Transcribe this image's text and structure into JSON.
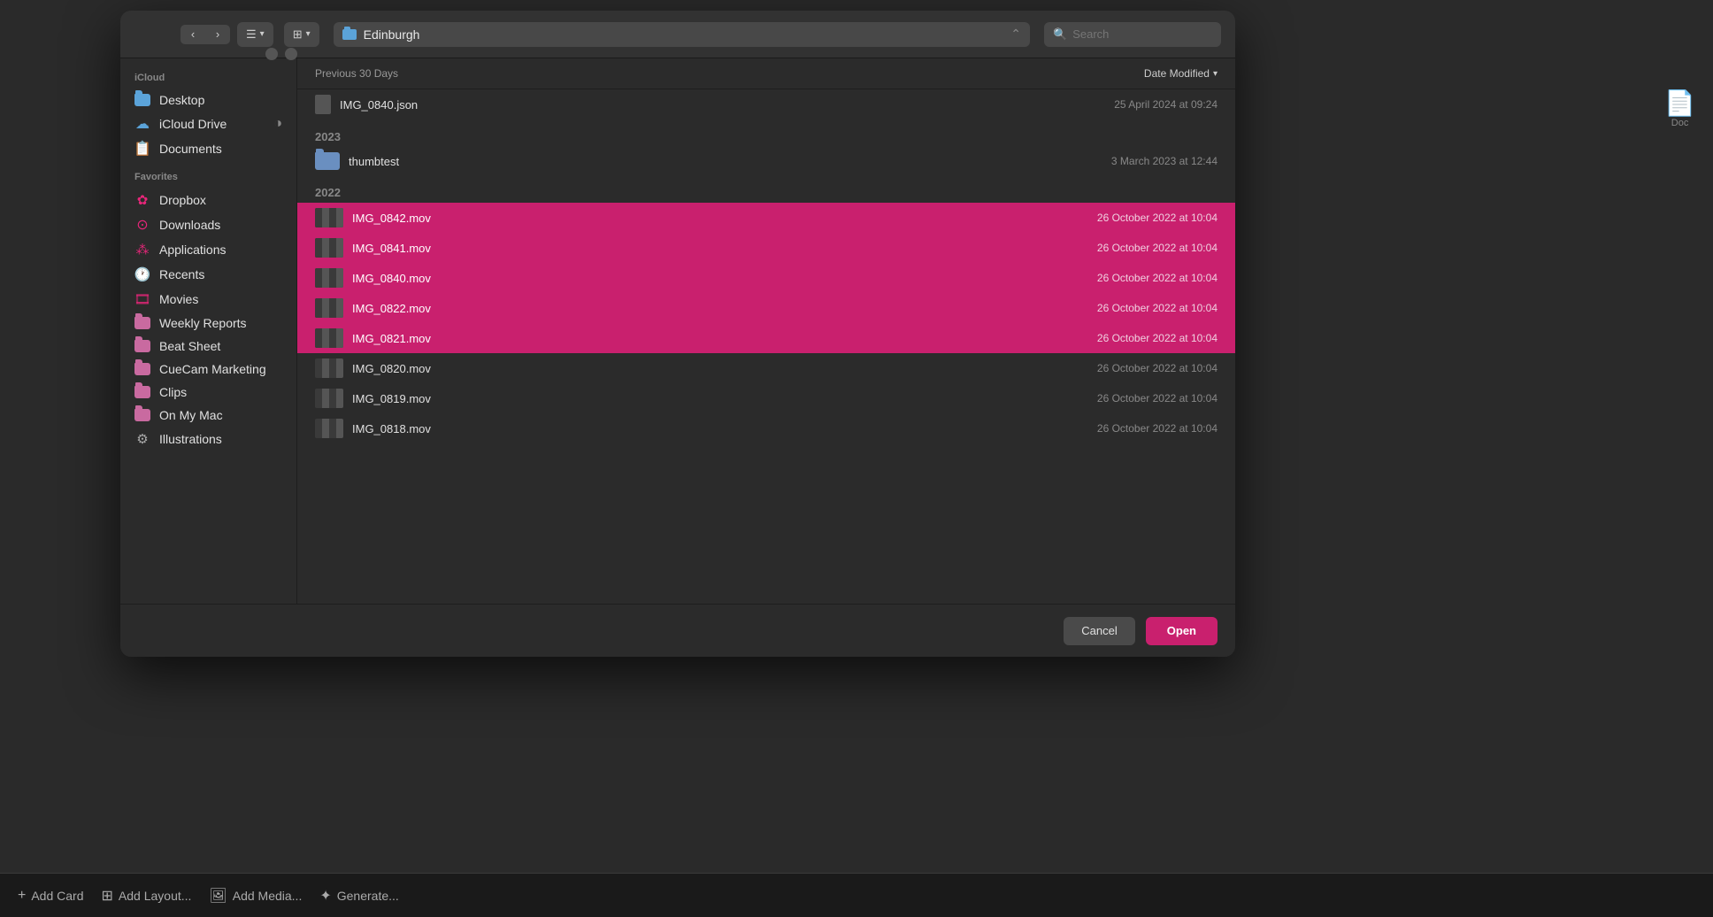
{
  "background": {
    "toolbar": {
      "items": [
        {
          "icon": "+",
          "label": "Add Card"
        },
        {
          "icon": "⊞",
          "label": "Add Layout..."
        },
        {
          "icon": "🖼",
          "label": "Add Media..."
        },
        {
          "icon": "✦",
          "label": "Generate..."
        }
      ]
    }
  },
  "dialog": {
    "toolbar": {
      "back_label": "‹",
      "forward_label": "›",
      "list_view_label": "☰",
      "grid_view_label": "⊞",
      "location": "Edinburgh",
      "search_placeholder": "Search"
    },
    "content_header": {
      "section_label": "Previous 30 Days",
      "date_col_label": "Date Modified"
    },
    "sidebar": {
      "icloud_section": "iCloud",
      "icloud_items": [
        {
          "id": "desktop",
          "label": "Desktop",
          "icon_type": "folder-blue"
        },
        {
          "id": "icloud-drive",
          "label": "iCloud Drive",
          "icon_type": "cloud"
        },
        {
          "id": "documents",
          "label": "Documents",
          "icon_type": "doc"
        }
      ],
      "favorites_section": "Favorites",
      "favorites_items": [
        {
          "id": "dropbox",
          "label": "Dropbox",
          "icon_type": "dropbox"
        },
        {
          "id": "downloads",
          "label": "Downloads",
          "icon_type": "downloads"
        },
        {
          "id": "applications",
          "label": "Applications",
          "icon_type": "grid"
        },
        {
          "id": "recents",
          "label": "Recents",
          "icon_type": "clock"
        },
        {
          "id": "movies",
          "label": "Movies",
          "icon_type": "film"
        },
        {
          "id": "weekly-reports",
          "label": "Weekly Reports",
          "icon_type": "folder"
        },
        {
          "id": "beat-sheet",
          "label": "Beat Sheet",
          "icon_type": "folder"
        },
        {
          "id": "cuecam-marketing",
          "label": "CueCam Marketing",
          "icon_type": "folder"
        },
        {
          "id": "clips",
          "label": "Clips",
          "icon_type": "folder"
        },
        {
          "id": "on-my-mac",
          "label": "On My Mac",
          "icon_type": "folder"
        },
        {
          "id": "illustrations",
          "label": "Illustrations",
          "icon_type": "gear"
        }
      ]
    },
    "file_groups": [
      {
        "year": "Previous 30 Days",
        "files": [
          {
            "id": "img0840-json",
            "name": "IMG_0840.json",
            "date": "25 April 2024 at 09:24",
            "type": "json",
            "selected": false
          }
        ]
      },
      {
        "year": "2023",
        "files": [
          {
            "id": "thumbtest",
            "name": "thumbtest",
            "date": "3 March 2023 at 12:44",
            "type": "folder",
            "selected": false
          }
        ]
      },
      {
        "year": "2022",
        "files": [
          {
            "id": "img0842",
            "name": "IMG_0842.mov",
            "date": "26 October 2022 at 10:04",
            "type": "mov",
            "selected": true
          },
          {
            "id": "img0841",
            "name": "IMG_0841.mov",
            "date": "26 October 2022 at 10:04",
            "type": "mov",
            "selected": true
          },
          {
            "id": "img0840",
            "name": "IMG_0840.mov",
            "date": "26 October 2022 at 10:04",
            "type": "mov",
            "selected": true
          },
          {
            "id": "img0822",
            "name": "IMG_0822.mov",
            "date": "26 October 2022 at 10:04",
            "type": "mov",
            "selected": true
          },
          {
            "id": "img0821",
            "name": "IMG_0821.mov",
            "date": "26 October 2022 at 10:04",
            "type": "mov",
            "selected": true
          },
          {
            "id": "img0820",
            "name": "IMG_0820.mov",
            "date": "26 October 2022 at 10:04",
            "type": "mov",
            "selected": false
          },
          {
            "id": "img0819",
            "name": "IMG_0819.mov",
            "date": "26 October 2022 at 10:04",
            "type": "mov",
            "selected": false
          },
          {
            "id": "img0818",
            "name": "IMG_0818.mov",
            "date": "26 October 2022 at 10:04",
            "type": "mov",
            "selected": false
          }
        ]
      }
    ],
    "footer": {
      "cancel_label": "Cancel",
      "open_label": "Open"
    }
  }
}
